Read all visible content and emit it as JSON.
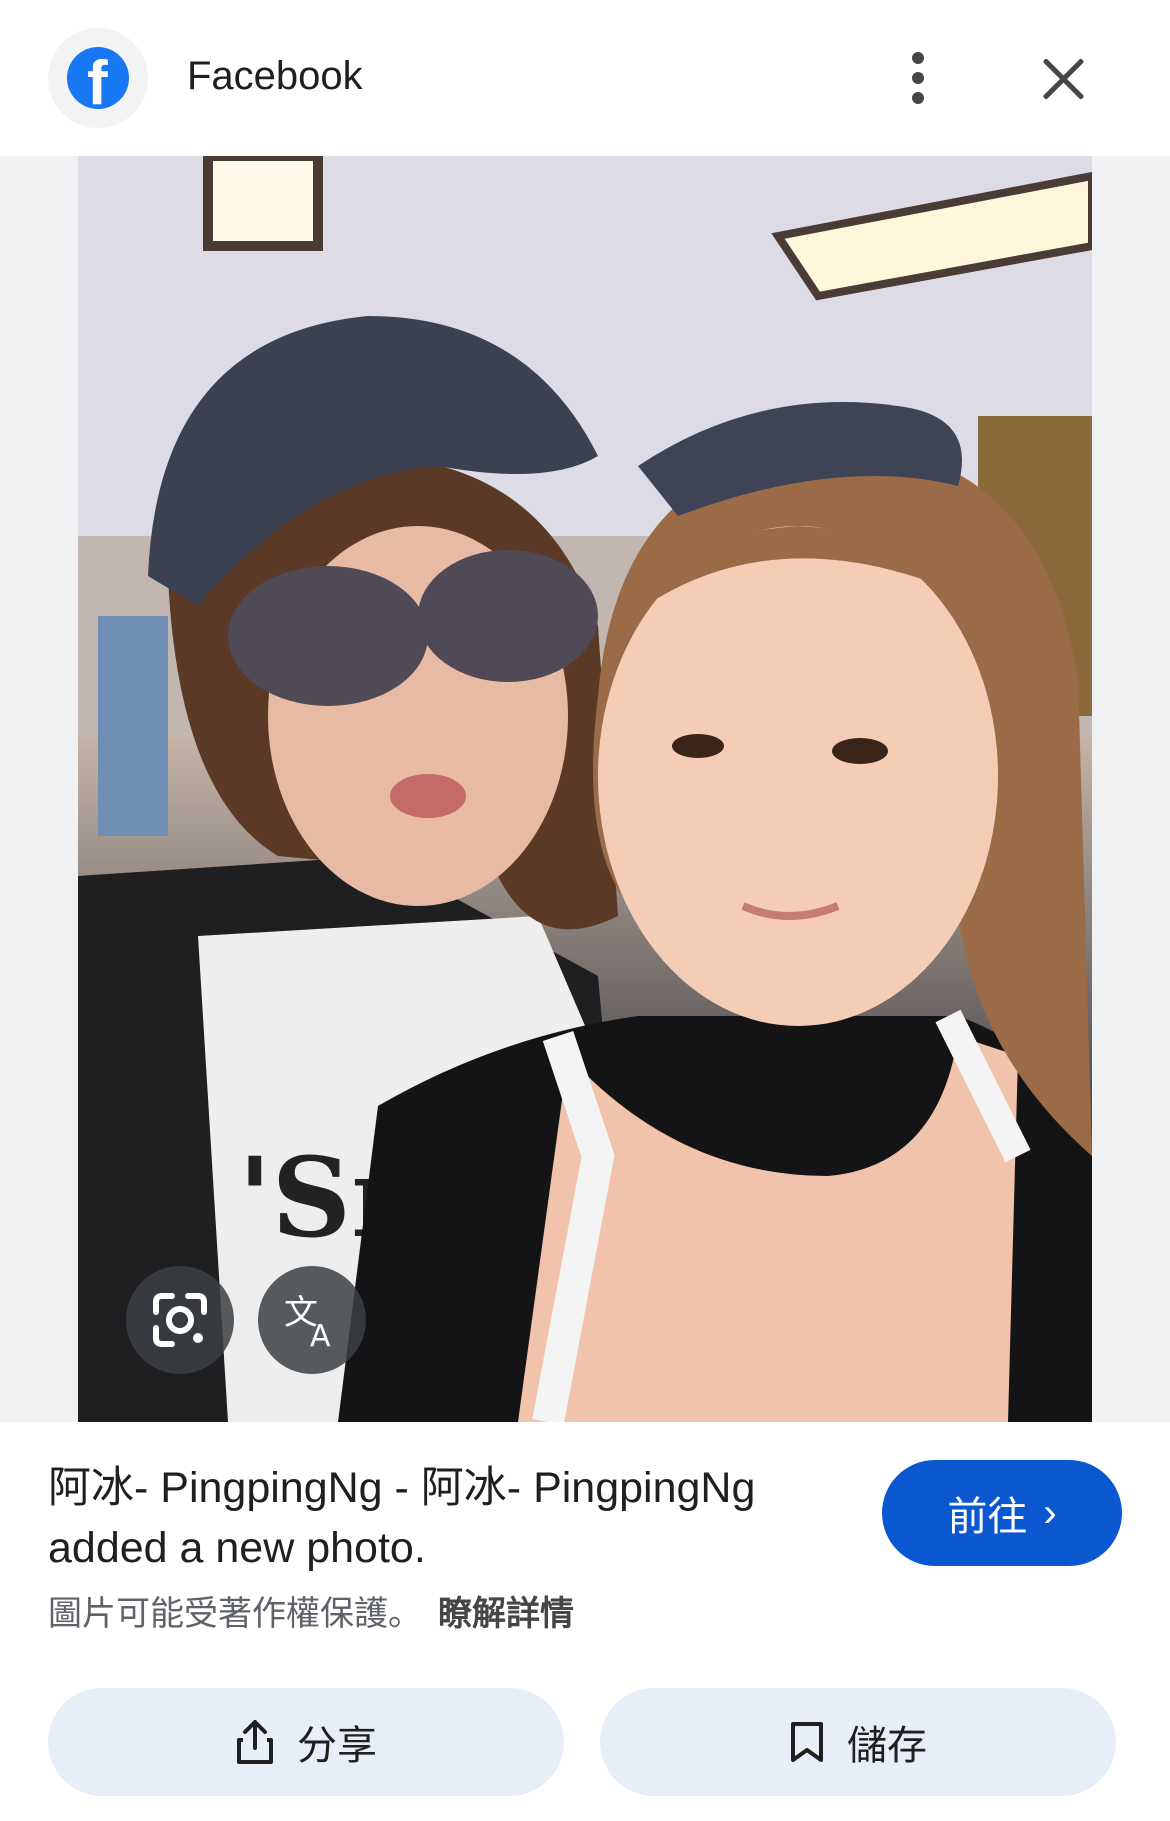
{
  "header": {
    "source_name": "Facebook",
    "logo_icon": "facebook-logo-icon",
    "more_icon": "more-vert-icon",
    "close_icon": "close-icon"
  },
  "image": {
    "overlay_buttons": {
      "lens_icon": "lens-search-icon",
      "translate_icon": "translate-icon"
    }
  },
  "result": {
    "title": "阿冰- PingpingNg - 阿冰- PingpingNg added a new photo.",
    "visit_label": "前往",
    "copyright_text": "圖片可能受著作權保護。",
    "learn_more": "瞭解詳情"
  },
  "actions": {
    "share_label": "分享",
    "save_label": "儲存"
  },
  "colors": {
    "primary": "#0b57d0",
    "facebook_blue": "#1877f2",
    "chip_bg": "#e8eef8"
  }
}
